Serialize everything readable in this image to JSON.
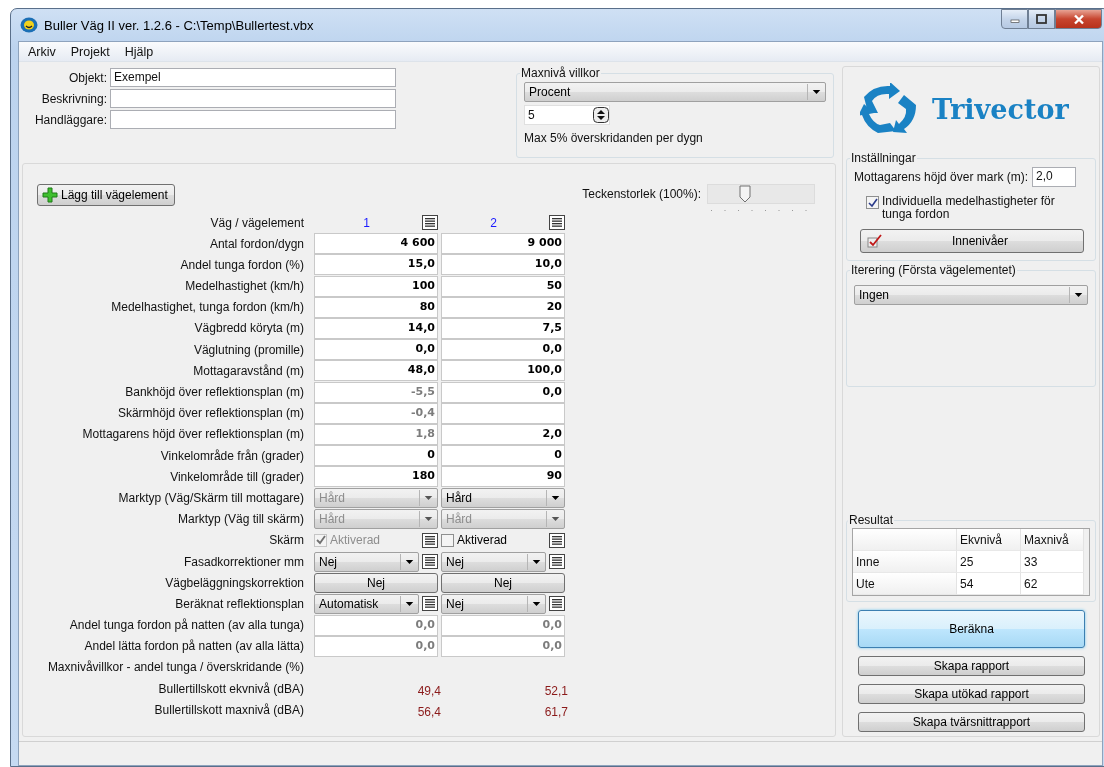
{
  "window": {
    "title": "Buller Väg II ver. 1.2.6 - C:\\Temp\\Bullertest.vbx"
  },
  "menu": [
    "Arkiv",
    "Projekt",
    "Hjälp"
  ],
  "project": [
    {
      "label": "Objekt:",
      "value": "Exempel"
    },
    {
      "label": "Beskrivning:"
    },
    {
      "label": "Handläggare:"
    }
  ],
  "maxniva": {
    "title": "Maxnivå villkor",
    "mode": "Procent",
    "value": "5",
    "note": "Max 5% överskridanden per dygn"
  },
  "add_button": "Lägg till vägelement",
  "font_size": {
    "label": "Teckenstorlek (100%):",
    "level": 0.35
  },
  "grid": {
    "rows": [
      {
        "label": "Väg / vägelement",
        "kind": "header",
        "cells": [
          {
            "text": "1"
          },
          {
            "text": "2"
          }
        ]
      },
      {
        "label": "Antal fordon/dygn",
        "kind": "input",
        "cells": [
          {
            "value": "4 600",
            "disabled": false
          },
          {
            "value": "9 000",
            "disabled": false
          }
        ]
      },
      {
        "label": "Andel tunga fordon (%)",
        "kind": "input",
        "cells": [
          {
            "value": "15,0",
            "disabled": false
          },
          {
            "value": "10,0",
            "disabled": false
          }
        ]
      },
      {
        "label": "Medelhastighet (km/h)",
        "kind": "input",
        "cells": [
          {
            "value": "100",
            "disabled": false
          },
          {
            "value": "50",
            "disabled": false
          }
        ]
      },
      {
        "label": "Medelhastighet, tunga fordon (km/h)",
        "kind": "input",
        "cells": [
          {
            "value": "80",
            "disabled": false
          },
          {
            "value": "20",
            "disabled": false
          }
        ]
      },
      {
        "label": "Vägbredd köryta (m)",
        "kind": "input",
        "cells": [
          {
            "value": "14,0",
            "disabled": false
          },
          {
            "value": "7,5",
            "disabled": false
          }
        ]
      },
      {
        "label": "Väglutning (promille)",
        "kind": "input",
        "cells": [
          {
            "value": "0,0",
            "disabled": false
          },
          {
            "value": "0,0",
            "disabled": false
          }
        ]
      },
      {
        "label": "Mottagaravstånd (m)",
        "kind": "input",
        "cells": [
          {
            "value": "48,0",
            "disabled": false
          },
          {
            "value": "100,0",
            "disabled": false
          }
        ]
      },
      {
        "label": "Bankhöjd över reflektionsplan (m)",
        "kind": "input",
        "cells": [
          {
            "value": "-5,5",
            "disabled": true
          },
          {
            "value": "0,0",
            "disabled": false
          }
        ]
      },
      {
        "label": "Skärmhöjd över reflektionsplan (m)",
        "kind": "input",
        "cells": [
          {
            "value": "-0,4",
            "disabled": true
          },
          {}
        ]
      },
      {
        "label": "Mottagarens höjd över reflektionsplan (m)",
        "kind": "input",
        "cells": [
          {
            "value": "1,8",
            "disabled": true
          },
          {
            "value": "2,0",
            "disabled": false
          }
        ]
      },
      {
        "label": "Vinkelområde från (grader)",
        "kind": "input",
        "cells": [
          {
            "value": "0",
            "disabled": false
          },
          {
            "value": "0",
            "disabled": false
          }
        ]
      },
      {
        "label": "Vinkelområde till (grader)",
        "kind": "input",
        "cells": [
          {
            "value": "180",
            "disabled": false
          },
          {
            "value": "90",
            "disabled": false
          }
        ]
      },
      {
        "label": "Marktyp (Väg/Skärm till mottagare)",
        "kind": "select",
        "cells": [
          {
            "value": "Hård",
            "disabled": true
          },
          {
            "value": "Hård",
            "disabled": false
          }
        ]
      },
      {
        "label": "Marktyp (Väg till skärm)",
        "kind": "select",
        "cells": [
          {
            "value": "Hård",
            "disabled": true
          },
          {
            "value": "Hård",
            "disabled": true
          }
        ]
      },
      {
        "label": "Skärm",
        "kind": "checkbox",
        "cells": [
          {
            "label": "Aktiverad",
            "checked": true,
            "disabled": true
          },
          {
            "label": "Aktiverad",
            "checked": false,
            "disabled": false
          }
        ]
      },
      {
        "label": "Fasadkorrektioner mm",
        "kind": "select_list",
        "cells": [
          {
            "value": "Nej",
            "disabled": false
          },
          {
            "value": "Nej",
            "disabled": false
          }
        ]
      },
      {
        "label": "Vägbeläggningskorrektion",
        "kind": "button",
        "cells": [
          {
            "label": "Nej"
          },
          {
            "label": "Nej"
          }
        ]
      },
      {
        "label": "Beräknat reflektionsplan",
        "kind": "select_list",
        "cells": [
          {
            "value": "Automatisk",
            "disabled": false
          },
          {
            "value": "Nej",
            "disabled": false
          }
        ]
      },
      {
        "label": "Andel tunga fordon på natten (av alla tunga)",
        "kind": "input",
        "cells": [
          {
            "value": "0,0",
            "disabled": true
          },
          {
            "value": "0,0",
            "disabled": true
          }
        ]
      },
      {
        "label": "Andel lätta fordon på natten (av alla lätta)",
        "kind": "input",
        "cells": [
          {
            "value": "0,0",
            "disabled": true
          },
          {
            "value": "0,0",
            "disabled": true
          }
        ]
      },
      {
        "label": "Maxnivåvillkor - andel tunga / överskridande (%)",
        "kind": "label"
      },
      {
        "label": "Bullertillskott ekvnivå (dBA)",
        "kind": "result",
        "cells": [
          {
            "value": "49,4"
          },
          {
            "value": "52,1"
          }
        ]
      },
      {
        "label": "Bullertillskott maxnivå (dBA)",
        "kind": "result",
        "cells": [
          {
            "value": "56,4"
          },
          {
            "value": "61,7"
          }
        ]
      }
    ]
  },
  "logo": {
    "text": "Trivector"
  },
  "settings": {
    "title": "Inställningar",
    "height_label": "Mottagarens höjd över mark (m):",
    "height_value": "2,0",
    "individual": {
      "label": "Individuella medelhastigheter för tunga fordon",
      "checked": true
    },
    "inner_button": "Innenivåer"
  },
  "iteration": {
    "title": "Iterering (Första vägelementet)",
    "value": "Ingen"
  },
  "results": {
    "title": "Resultat",
    "columns": [
      "Ekvnivå",
      "Maxnivå"
    ],
    "rows": [
      {
        "label": "Inne",
        "values": [
          "25",
          "33"
        ]
      },
      {
        "label": "Ute",
        "values": [
          "54",
          "62"
        ]
      }
    ]
  },
  "actions": [
    {
      "label": "Beräkna",
      "primary": true
    },
    {
      "label": "Skapa rapport",
      "primary": false
    },
    {
      "label": "Skapa utökad rapport",
      "primary": false
    },
    {
      "label": "Skapa tvärsnittrapport",
      "primary": false
    }
  ]
}
